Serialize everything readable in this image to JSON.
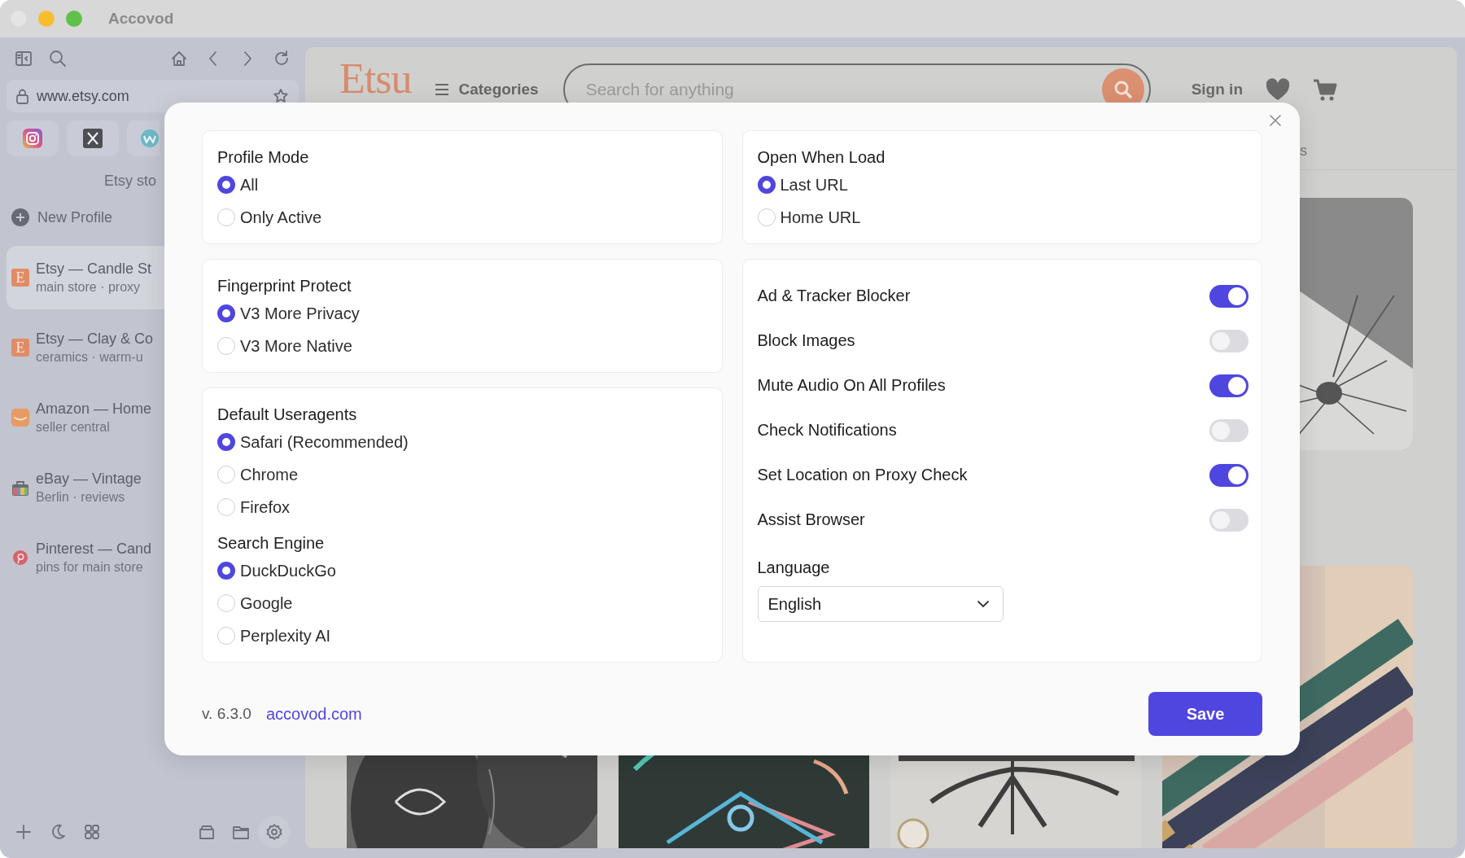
{
  "window": {
    "title": "Accovod"
  },
  "sidebar": {
    "address": "www.etsy.com",
    "group_label": "Etsy sto",
    "new_profile": "New Profile",
    "profiles": [
      {
        "title": "Etsy — Candle St",
        "subtitle": "main store · proxy",
        "kind": "letter",
        "badge": "E",
        "selected": true
      },
      {
        "title": "Etsy — Clay & Co",
        "subtitle": "ceramics · warm-u",
        "kind": "letter",
        "badge": "E",
        "selected": false
      },
      {
        "title": "Amazon — Home",
        "subtitle": "seller central",
        "kind": "smile",
        "selected": false
      },
      {
        "title": "eBay — Vintage",
        "subtitle": "Berlin · reviews",
        "kind": "bag",
        "selected": false
      },
      {
        "title": "Pinterest — Cand",
        "subtitle": "pins for main store",
        "kind": "pin",
        "selected": false
      }
    ]
  },
  "web_page": {
    "logo": "Etsu",
    "categories": "Categories",
    "search_placeholder": "Search for anything",
    "sign_in": "Sign in",
    "nav_fragment": "s"
  },
  "dialog": {
    "left_cards": [
      {
        "groups": [
          {
            "title": "Profile Mode",
            "options": [
              {
                "label": "All",
                "selected": true
              },
              {
                "label": "Only Active",
                "selected": false
              }
            ]
          }
        ]
      },
      {
        "groups": [
          {
            "title": "Fingerprint Protect",
            "options": [
              {
                "label": "V3 More Privacy",
                "selected": true
              },
              {
                "label": "V3 More Native",
                "selected": false
              }
            ]
          }
        ]
      },
      {
        "groups": [
          {
            "title": "Default Useragents",
            "options": [
              {
                "label": "Safari (Recommended)",
                "selected": true
              },
              {
                "label": "Chrome",
                "selected": false
              },
              {
                "label": "Firefox",
                "selected": false
              }
            ]
          },
          {
            "title": "Search Engine",
            "options": [
              {
                "label": "DuckDuckGo",
                "selected": true
              },
              {
                "label": "Google",
                "selected": false
              },
              {
                "label": "Perplexity AI",
                "selected": false
              }
            ]
          }
        ]
      }
    ],
    "right_cards": [
      {
        "groups": [
          {
            "title": "Open When Load",
            "options": [
              {
                "label": "Last URL",
                "selected": true
              },
              {
                "label": "Home URL",
                "selected": false
              }
            ]
          }
        ]
      }
    ],
    "toggles": [
      {
        "label": "Ad & Tracker Blocker",
        "on": true
      },
      {
        "label": "Block Images",
        "on": false
      },
      {
        "label": "Mute Audio On All Profiles",
        "on": true
      },
      {
        "label": "Check Notifications",
        "on": false
      },
      {
        "label": "Set Location on Proxy Check",
        "on": true
      },
      {
        "label": "Assist Browser",
        "on": false
      }
    ],
    "language": {
      "label": "Language",
      "value": "English"
    },
    "version": "v. 6.3.0",
    "link": "accovod.com",
    "save": "Save"
  }
}
